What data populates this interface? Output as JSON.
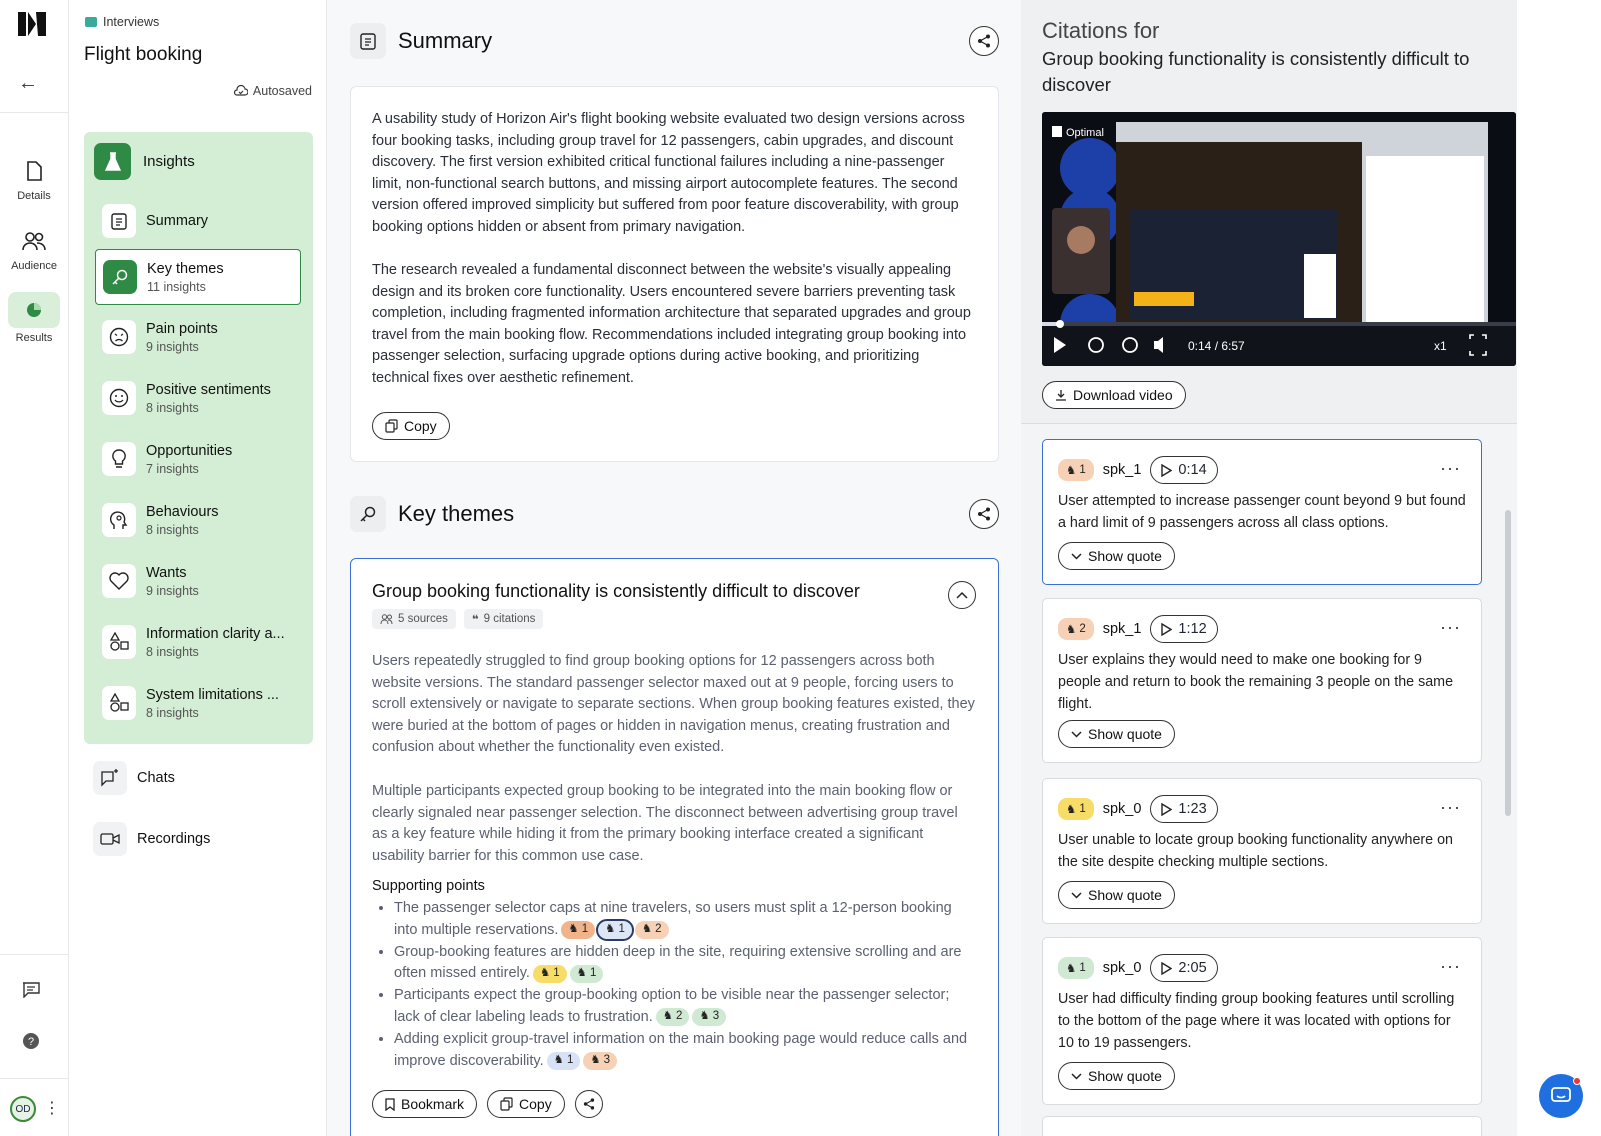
{
  "rail": {
    "items": [
      {
        "label": "Details"
      },
      {
        "label": "Audience"
      },
      {
        "label": "Results"
      }
    ],
    "avatar_initials": "OD"
  },
  "nav": {
    "breadcrumb": "Interviews",
    "title": "Flight booking",
    "autosave": "Autosaved",
    "insights_label": "Insights",
    "items": [
      {
        "label": "Summary",
        "count": ""
      },
      {
        "label": "Key themes",
        "count": "11 insights"
      },
      {
        "label": "Pain points",
        "count": "9 insights"
      },
      {
        "label": "Positive sentiments",
        "count": "8 insights"
      },
      {
        "label": "Opportunities",
        "count": "7 insights"
      },
      {
        "label": "Behaviours",
        "count": "8 insights"
      },
      {
        "label": "Wants",
        "count": "9 insights"
      },
      {
        "label": "Information clarity a...",
        "count": "8 insights"
      },
      {
        "label": "System limitations ...",
        "count": "8 insights"
      }
    ],
    "chats": "Chats",
    "recordings": "Recordings"
  },
  "summary": {
    "heading": "Summary",
    "p1": "A usability study of Horizon Air's flight booking website evaluated two design versions across four booking tasks, including group travel for 12 passengers, cabin upgrades, and discount discovery. The first version exhibited critical functional failures including a nine-passenger limit, non-functional search buttons, and missing airport autocomplete features. The second version offered improved simplicity but suffered from poor feature discoverability, with group booking options hidden or absent from primary navigation.",
    "p2": "The research revealed a fundamental disconnect between the website's visually appealing design and its broken core functionality. Users encountered severe barriers preventing task completion, including fragmented information architecture that separated upgrades and group travel from the main booking flow. Recommendations included integrating group booking into passenger selection, surfacing upgrade options during active booking, and prioritizing technical fixes over aesthetic refinement.",
    "copy": "Copy"
  },
  "key_themes": {
    "heading": "Key themes",
    "theme": {
      "title": "Group booking functionality is consistently difficult to discover",
      "sources": "5 sources",
      "citations": "9 citations",
      "p1": "Users repeatedly struggled to find group booking options for 12 passengers across both website versions. The standard passenger selector maxed out at 9 people, forcing users to scroll extensively or navigate to separate sections. When group booking features existed, they were buried at the bottom of pages or hidden in navigation menus, creating frustration and confusion about whether the functionality even existed.",
      "p2": "Multiple participants expected group booking to be integrated into the main booking flow or clearly signaled near passenger selection. The disconnect between advertising group travel as a key feature while hiding it from the primary booking interface created a significant usability barrier for this common use case.",
      "supporting_heading": "Supporting points",
      "points": [
        {
          "text": "The passenger selector caps at nine travelers, so users must split a 12-person booking into multiple reservations.",
          "tags": [
            {
              "n": "1",
              "c": "orange"
            },
            {
              "n": "1",
              "c": "outline"
            },
            {
              "n": "2",
              "c": "peach"
            }
          ]
        },
        {
          "text": "Group-booking features are hidden deep in the site, requiring extensive scrolling and are often missed entirely.",
          "tags": [
            {
              "n": "1",
              "c": "yellow"
            },
            {
              "n": "1",
              "c": "green"
            }
          ]
        },
        {
          "text": "Participants expect the group-booking option to be visible near the passenger selector; lack of clear labeling leads to frustration.",
          "tags": [
            {
              "n": "2",
              "c": "green"
            },
            {
              "n": "3",
              "c": "green"
            }
          ]
        },
        {
          "text": "Adding explicit group-travel information on the main booking page would reduce calls and improve discoverability.",
          "tags": [
            {
              "n": "1",
              "c": "blue"
            },
            {
              "n": "3",
              "c": "peach"
            }
          ]
        }
      ],
      "bookmark": "Bookmark",
      "copy": "Copy"
    }
  },
  "citations": {
    "heading": "Citations for",
    "title": "Group booking functionality is consistently difficult to discover",
    "video": {
      "brand": "Optimal",
      "time": "0:14 / 6:57",
      "speed": "x1"
    },
    "download": "Download video",
    "show_quote": "Show quote",
    "cards": [
      {
        "n": "1",
        "color": "peach",
        "speaker": "spk_1",
        "time": "0:14",
        "text": "User attempted to increase passenger count beyond 9 but found a hard limit of 9 passengers across all class options."
      },
      {
        "n": "2",
        "color": "peach",
        "speaker": "spk_1",
        "time": "1:12",
        "text": "User explains they would need to make one booking for 9 people and return to book the remaining 3 people on the same flight."
      },
      {
        "n": "1",
        "color": "yellow",
        "speaker": "spk_0",
        "time": "1:23",
        "text": "User unable to locate group booking functionality anywhere on the site despite checking multiple sections."
      },
      {
        "n": "1",
        "color": "green",
        "speaker": "spk_0",
        "time": "2:05",
        "text": "User had difficulty finding group booking features until scrolling to the bottom of the page where it was located with options for 10 to 19 passengers."
      }
    ]
  },
  "colors": {
    "accent_green": "#2f8a45",
    "active_blue": "#3a6fd8",
    "insights_bg": "#d4edd5"
  }
}
